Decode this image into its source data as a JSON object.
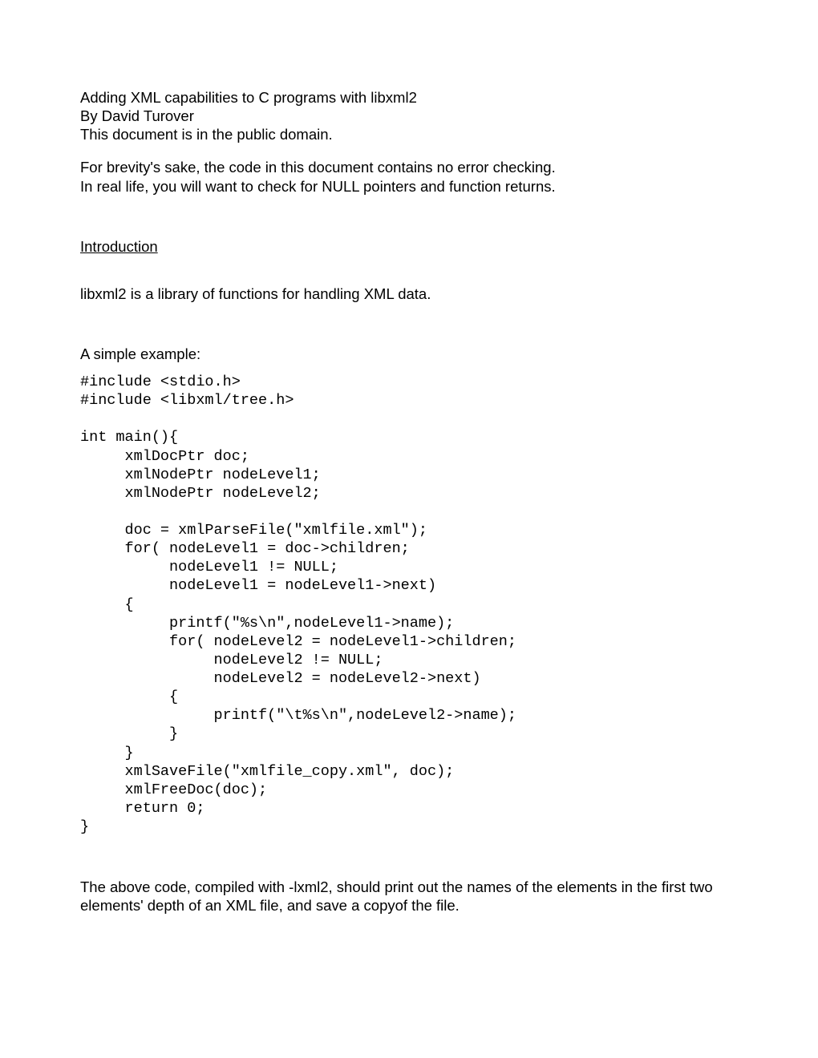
{
  "header": {
    "title": "Adding XML capabilities to C programs with libxml2",
    "author": "By David Turover",
    "license": "This document is in the public domain."
  },
  "intro": {
    "caveat1": "For brevity's sake, the code in this document contains no error checking.",
    "caveat2": "In real life, you will want to check for NULL pointers and function returns."
  },
  "section": {
    "heading": "Introduction",
    "desc": "libxml2 is a library of functions for handling XML data.",
    "example_label": "A simple example:"
  },
  "code": "#include <stdio.h>\n#include <libxml/tree.h>\n\nint main(){\n     xmlDocPtr doc;\n     xmlNodePtr nodeLevel1;\n     xmlNodePtr nodeLevel2;\n\n     doc = xmlParseFile(\"xmlfile.xml\");\n     for( nodeLevel1 = doc->children;\n          nodeLevel1 != NULL;\n          nodeLevel1 = nodeLevel1->next)\n     {\n          printf(\"%s\\n\",nodeLevel1->name);\n          for( nodeLevel2 = nodeLevel1->children;\n               nodeLevel2 != NULL;\n               nodeLevel2 = nodeLevel2->next)\n          {\n               printf(\"\\t%s\\n\",nodeLevel2->name);\n          }\n     }\n     xmlSaveFile(\"xmlfile_copy.xml\", doc);\n     xmlFreeDoc(doc);\n     return 0;\n}",
  "closing": "The above code, compiled with -lxml2, should print out the names of the elements in the first two elements' depth of an XML file, and save a copyof the file."
}
